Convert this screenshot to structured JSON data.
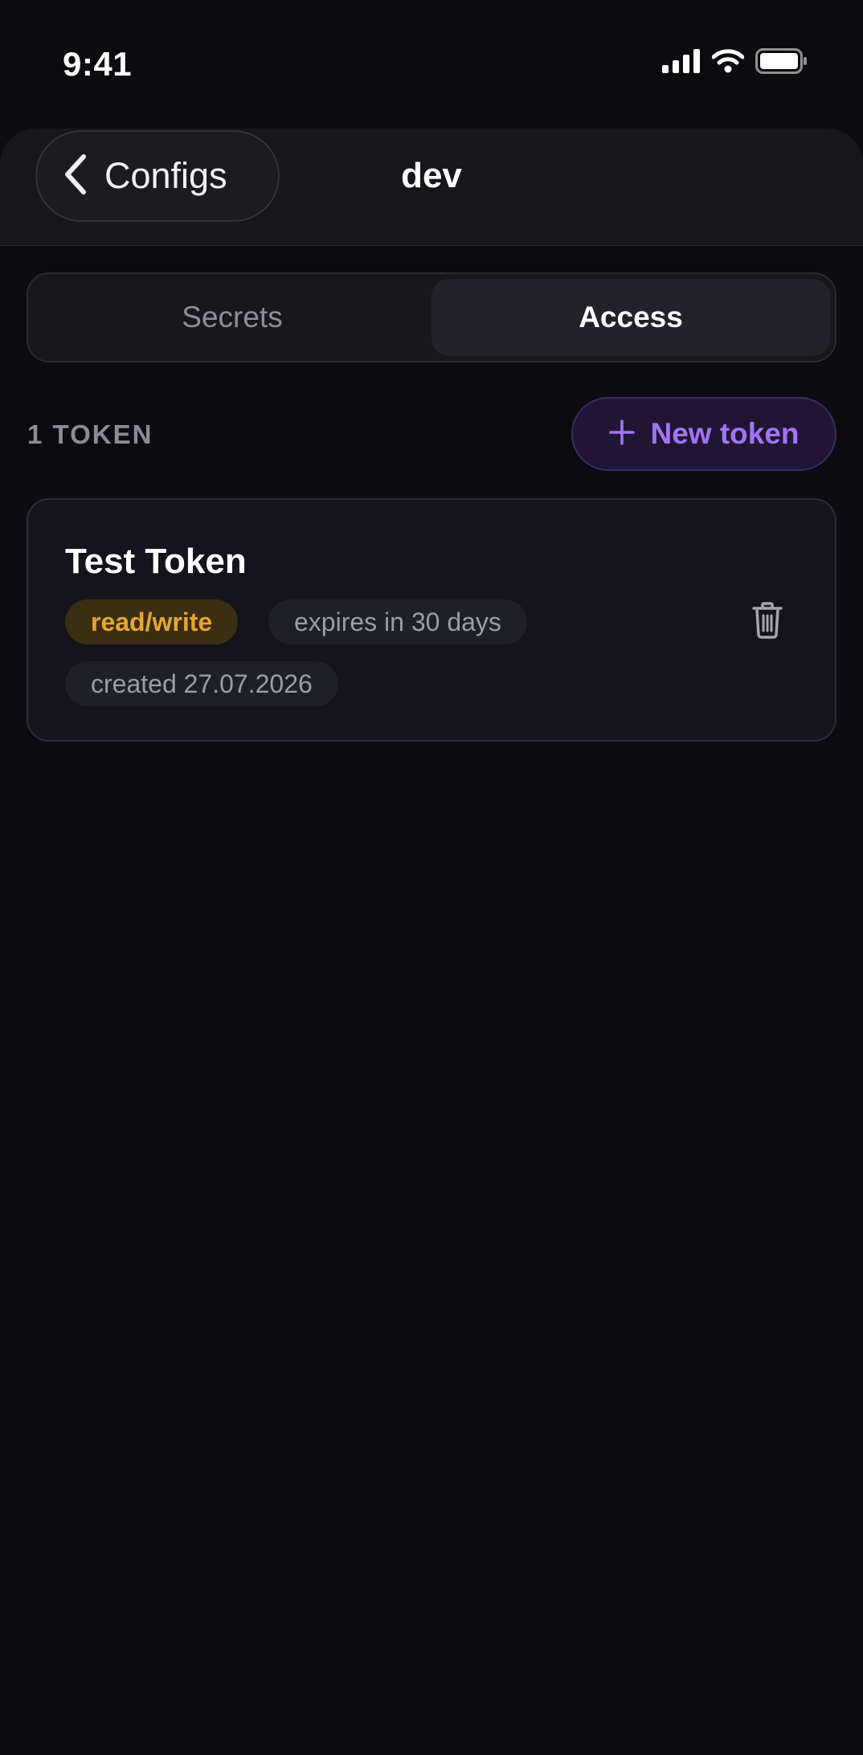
{
  "status_bar": {
    "time": "9:41"
  },
  "nav": {
    "back_label": "Configs",
    "title": "dev"
  },
  "segments": {
    "secrets": "Secrets",
    "access": "Access",
    "selected": "Access"
  },
  "tokens": {
    "count_label": "1 TOKEN",
    "new_token_label": "New token",
    "items": [
      {
        "name": "Test Token",
        "permission": "read/write",
        "expires": "expires in 30 days",
        "created": "created 27.07.2026"
      }
    ]
  },
  "colors": {
    "background": "#0c0c10",
    "accent": "#a474f6",
    "permission_text": "#e7a534",
    "permission_bg": "#3b2e12",
    "muted_text": "#8c8c95"
  },
  "icons": {
    "signal": "cellular-signal-icon",
    "wifi": "wifi-icon",
    "battery": "battery-icon",
    "back": "chevron-left-icon",
    "add": "plus-icon",
    "delete": "trash-icon"
  }
}
